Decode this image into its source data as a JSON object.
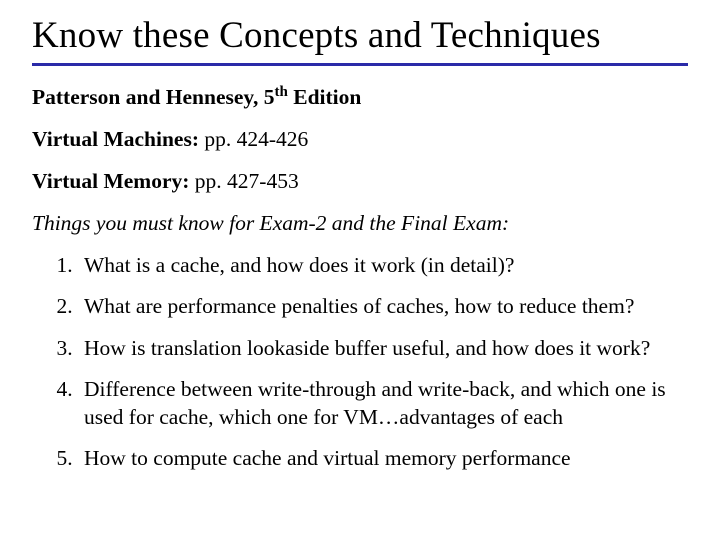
{
  "title": "Know these Concepts and Techniques",
  "reference": {
    "prefix": "Patterson and Hennesey, 5",
    "sup": "th",
    "suffix": " Edition"
  },
  "topics": {
    "vm_label": "Virtual Machines:",
    "vm_pages": " pp. 424-426",
    "vmem_label": "Virtual Memory:",
    "vmem_pages": "   pp. 427-453"
  },
  "exam_note": "Things you must know for Exam-2 and the Final Exam:",
  "questions": [
    "What is a cache, and how does it work (in detail)?",
    "What are performance penalties of caches, how to reduce them?",
    "How is translation lookaside buffer useful, and how does it work?",
    "Difference between write-through and write-back, and which one is used for cache, which one for VM…advantages of each",
    "How to compute cache  and  virtual memory performance"
  ]
}
